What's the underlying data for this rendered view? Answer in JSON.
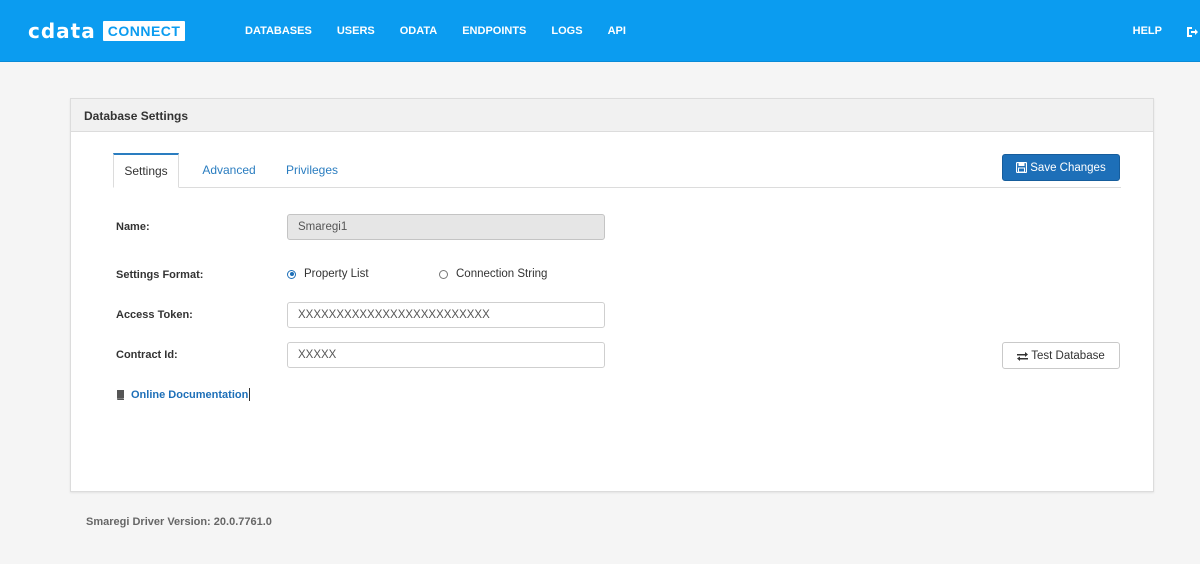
{
  "header": {
    "logo_word": "cdata",
    "logo_badge": "CONNECT",
    "nav": [
      "DATABASES",
      "USERS",
      "ODATA",
      "ENDPOINTS",
      "LOGS",
      "API"
    ],
    "help_label": "HELP",
    "signout_icon": "sign-out-icon",
    "brand_color": "#0b9cf0"
  },
  "panel": {
    "title": "Database Settings",
    "tabs": [
      {
        "label": "Settings",
        "active": true
      },
      {
        "label": "Advanced",
        "active": false
      },
      {
        "label": "Privileges",
        "active": false
      }
    ],
    "save_button": "Save Changes",
    "save_icon": "floppy-disk-icon",
    "fields": {
      "name_label": "Name:",
      "name_value": "Smaregi1",
      "format_label": "Settings Format:",
      "format_options": [
        "Property List",
        "Connection String"
      ],
      "format_selected": "Property List",
      "token_label": "Access Token:",
      "token_value": "XXXXXXXXXXXXXXXXXXXXXXXXX",
      "contract_label": "Contract Id:",
      "contract_value": "XXXXX"
    },
    "test_button": "Test Database",
    "test_icon": "exchange-arrows-icon",
    "doc_link": "Online Documentation",
    "doc_icon": "book-icon"
  },
  "footer": {
    "version_text": "Smaregi Driver Version: 20.0.7761.0"
  }
}
